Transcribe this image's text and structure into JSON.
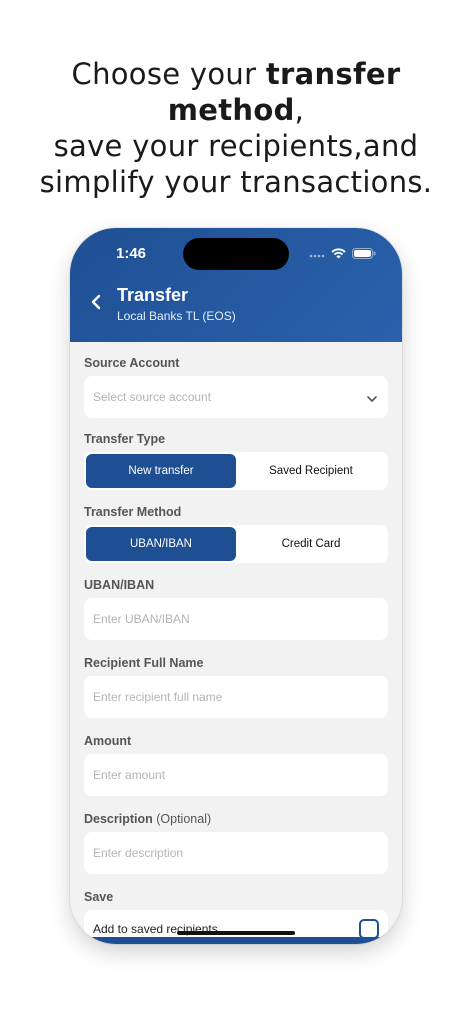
{
  "headline": {
    "line1_pre": "Choose your ",
    "line1_bold": "transfer method",
    "line1_post": ",",
    "line2": "save your recipients,and",
    "line3": "simplify your transactions."
  },
  "status": {
    "time": "1:46"
  },
  "nav": {
    "title": "Transfer",
    "subtitle": "Local Banks TL (EOS)"
  },
  "form": {
    "source_account": {
      "label": "Source Account",
      "placeholder": "Select source account"
    },
    "transfer_type": {
      "label": "Transfer Type",
      "options": [
        "New transfer",
        "Saved Recipient"
      ],
      "selected": "New transfer"
    },
    "transfer_method": {
      "label": "Transfer Method",
      "options": [
        "UBAN/IBAN",
        "Credit Card"
      ],
      "selected": "UBAN/IBAN"
    },
    "iban": {
      "label": "UBAN/IBAN",
      "placeholder": "Enter UBAN/IBAN"
    },
    "recipient_name": {
      "label": "Recipient Full Name",
      "placeholder": "Enter recipient full name"
    },
    "amount": {
      "label": "Amount",
      "placeholder": "Enter amount"
    },
    "description": {
      "label": "Description",
      "optional": "(Optional)",
      "placeholder": "Enter description"
    },
    "save": {
      "label": "Save",
      "checkbox_label": "Add to saved recipients",
      "checked": false
    }
  },
  "colors": {
    "primary": "#1f4f93",
    "background": "#f2f2f2",
    "placeholder": "#b4b4b4"
  }
}
